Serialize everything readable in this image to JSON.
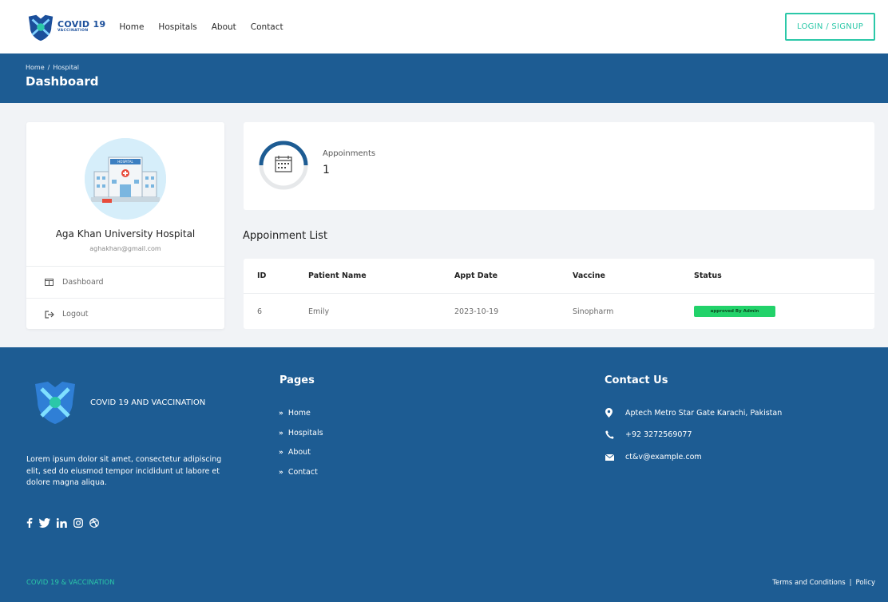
{
  "nav": {
    "brand_main": "COVID 19",
    "brand_sub": "VACCINATION",
    "links": [
      "Home",
      "Hospitals",
      "About",
      "Contact"
    ],
    "login_label": "LOGIN / SIGNUP"
  },
  "header": {
    "breadcrumb": [
      "Home",
      "/",
      "Hospital"
    ],
    "title": "Dashboard"
  },
  "profile": {
    "name": "Aga Khan University Hospital",
    "email": "aghakhan@gmail.com",
    "avatar_sign": "HOSPITAL",
    "menu": [
      {
        "label": "Dashboard",
        "icon": "columns-icon"
      },
      {
        "label": "Logout",
        "icon": "logout-icon"
      }
    ]
  },
  "appointments": {
    "label": "Appoinments",
    "count": "1"
  },
  "list": {
    "title": "Appoinment List",
    "columns": [
      "ID",
      "Patient Name",
      "Appt Date",
      "Vaccine",
      "Status"
    ],
    "rows": [
      {
        "id": "6",
        "patient": "Emily",
        "date": "2023-10-19",
        "vaccine": "Sinopharm",
        "status": "approved By Admin"
      }
    ]
  },
  "footer": {
    "brand": "COVID 19 AND VACCINATION",
    "description": "Lorem ipsum dolor sit amet, consectetur adipiscing elit, sed do eiusmod tempor incididunt ut labore et dolore magna aliqua.",
    "social": [
      "facebook-icon",
      "twitter-icon",
      "linkedin-icon",
      "instagram-icon",
      "dribbble-icon"
    ],
    "pages_title": "Pages",
    "pages": [
      "Home",
      "Hospitals",
      "About",
      "Contact"
    ],
    "contact_title": "Contact Us",
    "address": "Aptech Metro Star Gate Karachi, Pakistan",
    "phone": "+92 3272569077",
    "email": "ct&v@example.com",
    "copyright": "COVID 19 & VACCINATION",
    "terms": "Terms and Conditions",
    "separator": "|",
    "policy": "Policy"
  },
  "colors": {
    "primary": "#1d5c93",
    "accent": "#2bc8a8",
    "success": "#22d26a"
  }
}
